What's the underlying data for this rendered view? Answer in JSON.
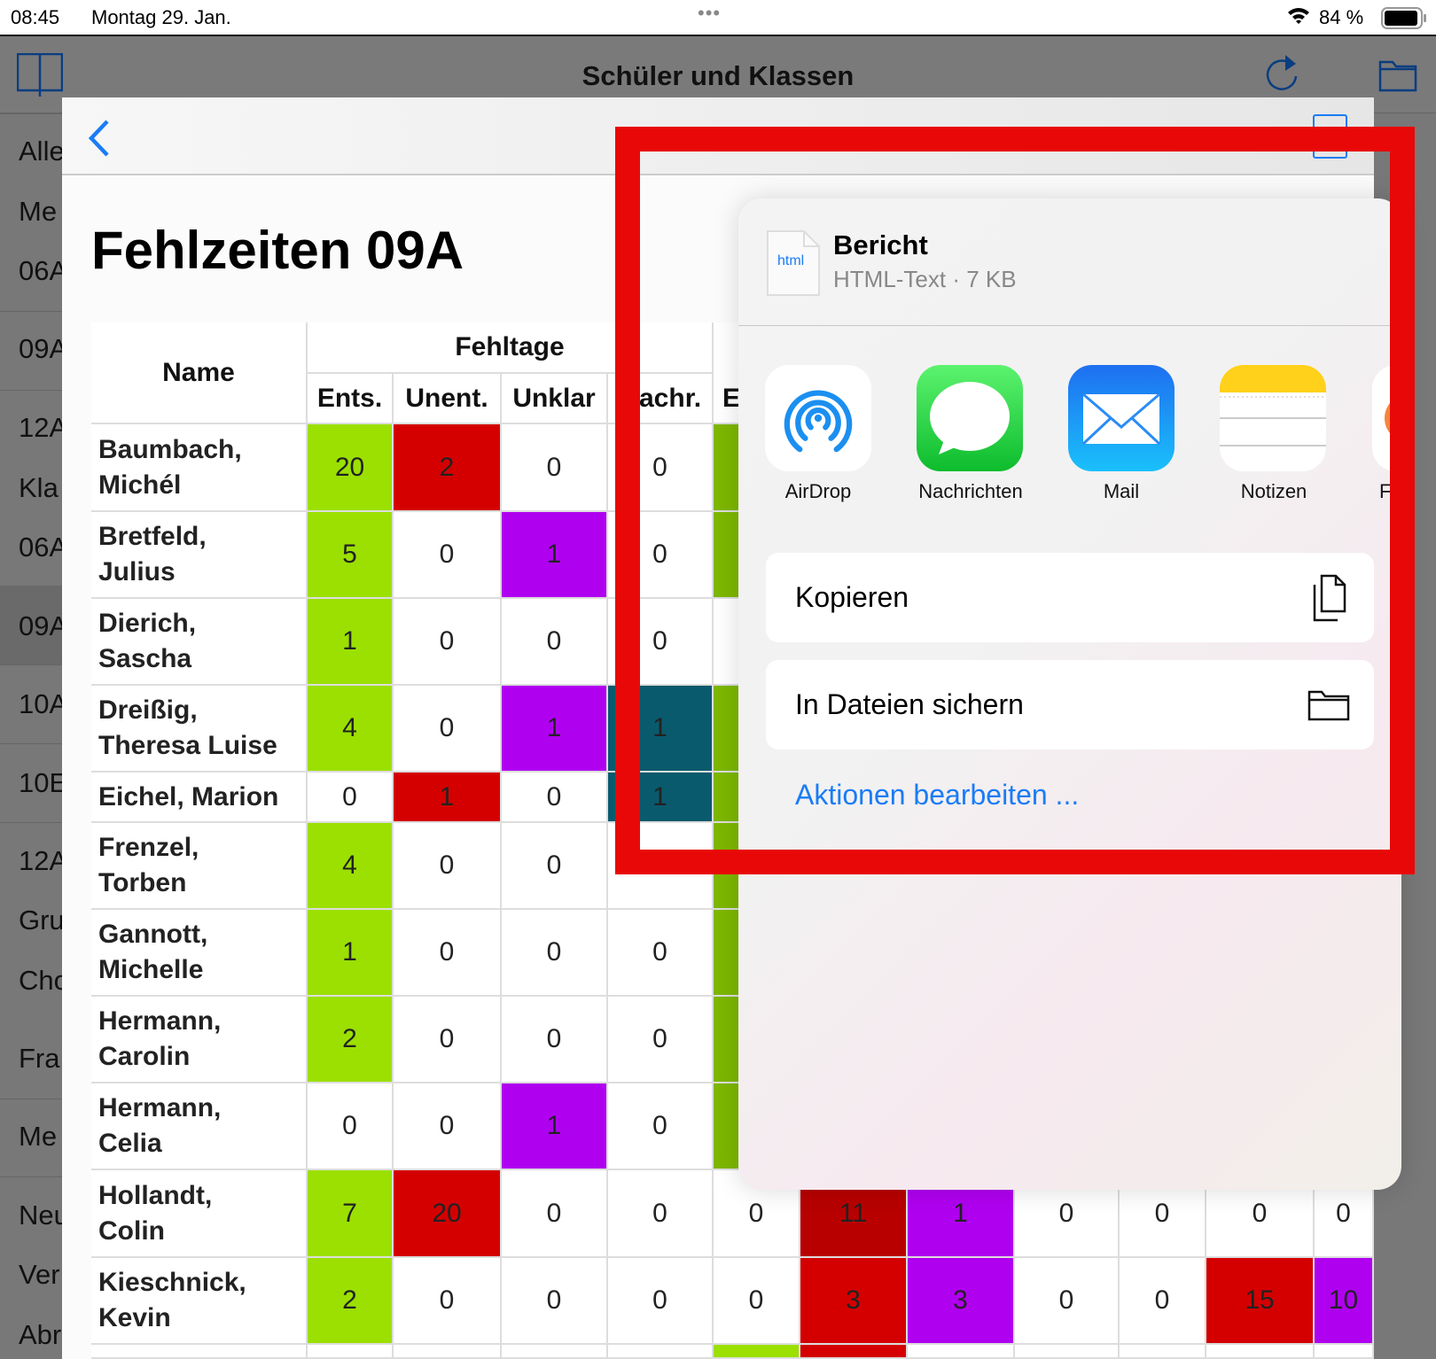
{
  "status_bar": {
    "time": "08:45",
    "date": "Montag 29. Jan.",
    "battery": "84 %"
  },
  "nav": {
    "title": "Schüler und Klassen",
    "icons": [
      "sidebar-icon",
      "refresh-icon",
      "folder-icon"
    ]
  },
  "sidebar": {
    "items": [
      "Alle",
      "Me",
      "06A",
      "09A",
      "12A",
      "Kla",
      "06A",
      "09A",
      "10A",
      "10E",
      "12A",
      "Gru",
      "Cho",
      "Fra",
      "Me",
      "Neu",
      "Ver",
      "Abr"
    ],
    "selected": "09A"
  },
  "page": {
    "title": "Fehlzeiten 09A"
  },
  "table": {
    "headers": {
      "name": "Name",
      "group": "Fehltage",
      "cols": [
        "Ents.",
        "Unent.",
        "Unklar",
        "achr.",
        "E"
      ]
    },
    "colors": {
      "green": "#9be000",
      "red": "#d40000",
      "purple": "#b000f0",
      "teal": "#0a5a6e",
      "darkgreen": "#7db700",
      "darkred": "#b80000"
    },
    "rows": [
      {
        "name": "Baumbach,\nMichél",
        "values": [
          "20",
          "2",
          "0",
          "0"
        ],
        "colors": [
          "green",
          "red",
          "",
          ""
        ],
        "e": "darkgreen"
      },
      {
        "name": "Bretfeld,\nJulius",
        "values": [
          "5",
          "0",
          "1",
          "0"
        ],
        "colors": [
          "green",
          "",
          "purple",
          ""
        ],
        "e": "darkgreen"
      },
      {
        "name": "Dierich,\nSascha",
        "values": [
          "1",
          "0",
          "0",
          "0"
        ],
        "colors": [
          "green",
          "",
          "",
          ""
        ],
        "e": ""
      },
      {
        "name": "Dreißig,\nTheresa Luise",
        "values": [
          "4",
          "0",
          "1",
          "1"
        ],
        "colors": [
          "green",
          "",
          "purple",
          "teal"
        ],
        "e": "darkgreen"
      },
      {
        "name": "Eichel, Marion",
        "values": [
          "0",
          "1",
          "0",
          "1"
        ],
        "colors": [
          "",
          "red",
          "",
          "teal"
        ],
        "e": "darkgreen"
      },
      {
        "name": "Frenzel,\nTorben",
        "values": [
          "4",
          "0",
          "0",
          ""
        ],
        "colors": [
          "green",
          "",
          "",
          ""
        ],
        "e": "darkgreen"
      },
      {
        "name": "Gannott,\nMichelle",
        "values": [
          "1",
          "0",
          "0",
          "0"
        ],
        "colors": [
          "green",
          "",
          "",
          ""
        ],
        "e": "darkgreen"
      },
      {
        "name": "Hermann,\nCarolin",
        "values": [
          "2",
          "0",
          "0",
          "0"
        ],
        "colors": [
          "green",
          "",
          "",
          ""
        ],
        "e": "darkgreen"
      },
      {
        "name": "Hermann,\nCelia",
        "values": [
          "0",
          "0",
          "1",
          "0"
        ],
        "colors": [
          "",
          "",
          "purple",
          ""
        ],
        "e": "darkgreen"
      },
      {
        "name": "Hollandt,\nColin",
        "values": [
          "7",
          "20",
          "0",
          "0",
          "0",
          "11",
          "1",
          "0",
          "0",
          "0",
          "0"
        ],
        "colors": [
          "green",
          "red",
          "",
          "",
          "",
          "darkred",
          "purple",
          "",
          "",
          "",
          ""
        ]
      },
      {
        "name": "Kieschnick,\nKevin",
        "values": [
          "2",
          "0",
          "0",
          "0",
          "0",
          "3",
          "3",
          "0",
          "0",
          "15",
          "10"
        ],
        "colors": [
          "green",
          "",
          "",
          "",
          "",
          "red",
          "purple",
          "",
          "",
          "red",
          "purple"
        ]
      },
      {
        "name": "",
        "values": [
          "",
          "",
          "",
          "",
          "",
          "",
          "",
          "",
          "",
          "",
          ""
        ],
        "colors": [
          "",
          "",
          "",
          "",
          "green",
          "red",
          "",
          "",
          "",
          "",
          ""
        ]
      }
    ]
  },
  "share": {
    "file": {
      "icon_label": "html",
      "name": "Bericht",
      "meta": "HTML-Text · 7 KB"
    },
    "apps": [
      {
        "label": "AirDrop",
        "icon": "airdrop-icon"
      },
      {
        "label": "Nachrichten",
        "icon": "messages-icon"
      },
      {
        "label": "Mail",
        "icon": "mail-icon"
      },
      {
        "label": "Notizen",
        "icon": "notes-icon"
      },
      {
        "label": "F",
        "icon": "app-icon"
      }
    ],
    "actions": [
      {
        "label": "Kopieren",
        "icon": "copy-icon"
      },
      {
        "label": "In Dateien sichern",
        "icon": "folder-icon"
      }
    ],
    "edit_actions": "Aktionen bearbeiten ...",
    "accent": "#1a7cf5"
  },
  "annotation": {
    "color": "#e80808"
  }
}
